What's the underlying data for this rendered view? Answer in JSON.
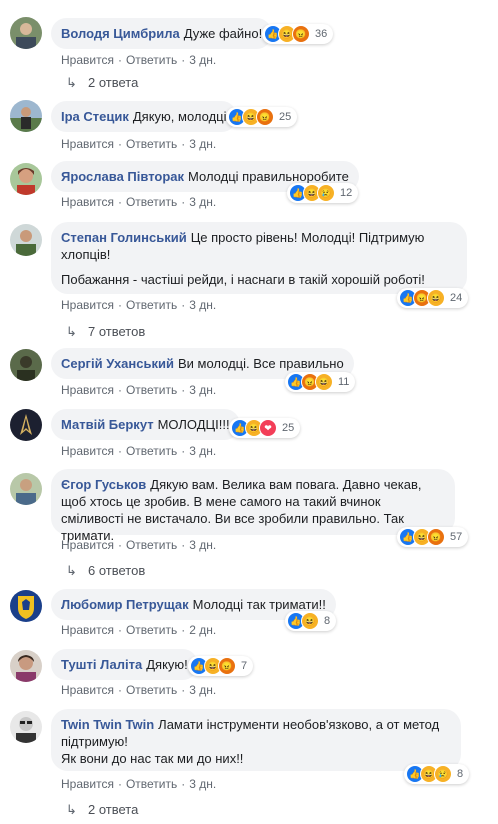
{
  "actions": {
    "like": "Нравится",
    "reply": "Ответить",
    "dot": "·"
  },
  "reply_arrow": "↳",
  "comments": [
    {
      "author": "Володя Цимбрила",
      "text": [
        "Дуже файно!"
      ],
      "reactions": [
        "like",
        "haha",
        "angry"
      ],
      "count": "36",
      "time": "3 дн.",
      "replies": "2 ответа"
    },
    {
      "author": "Іра Стецик",
      "text": [
        "Дякую, молодці"
      ],
      "reactions": [
        "like",
        "haha",
        "angry"
      ],
      "count": "25",
      "time": "3 дн."
    },
    {
      "author": "Ярослава Півторак",
      "text": [
        "Молодці правильноробите"
      ],
      "reactions": [
        "like",
        "haha",
        "sad"
      ],
      "count": "12",
      "time": "3 дн."
    },
    {
      "author": "Степан Голинський",
      "text": [
        "Це просто рівень! Молодці! Підтримую хлопців!",
        "Побажання - частіші рейди, і наснаги в такій хорошій роботі!"
      ],
      "reactions": [
        "like",
        "angry",
        "haha"
      ],
      "count": "24",
      "time": "3 дн.",
      "replies": "7 ответов"
    },
    {
      "author": "Сергій Уханський",
      "text": [
        "Ви молодці. Все правильно"
      ],
      "reactions": [
        "like",
        "angry",
        "haha"
      ],
      "count": "11",
      "time": "3 дн."
    },
    {
      "author": "Матвій Беркут",
      "text": [
        "МОЛОДЦІ!!!"
      ],
      "reactions": [
        "like",
        "haha",
        "love"
      ],
      "count": "25",
      "time": "3 дн."
    },
    {
      "author": "Єгор Гуськов",
      "text": [
        "Дякую вам. Велика вам повага. Давно чекав, щоб хтось це зробив. В мене самого на такий вчинок сміливості не вистачало. Ви все зробили правильно. Так тримати."
      ],
      "reactions": [
        "like",
        "haha",
        "angry"
      ],
      "count": "57",
      "time": "3 дн.",
      "replies": "6 ответов"
    },
    {
      "author": "Любомир Петрущак",
      "text": [
        "Молодці так тримати!!"
      ],
      "reactions": [
        "like",
        "haha"
      ],
      "count": "8",
      "time": "2 дн."
    },
    {
      "author": "Тушті Лаліта",
      "text": [
        "Дякую!"
      ],
      "reactions": [
        "like",
        "haha",
        "angry"
      ],
      "count": "7",
      "time": "3 дн."
    },
    {
      "author": "Twin Twin Twin",
      "text": [
        "Ламати інструменти необов'язково, а от метод підтримую!",
        "Як вони до нас так ми до них!!"
      ],
      "reactions": [
        "like",
        "haha",
        "sad"
      ],
      "count": "8",
      "time": "3 дн.",
      "replies": "2 ответа"
    }
  ]
}
